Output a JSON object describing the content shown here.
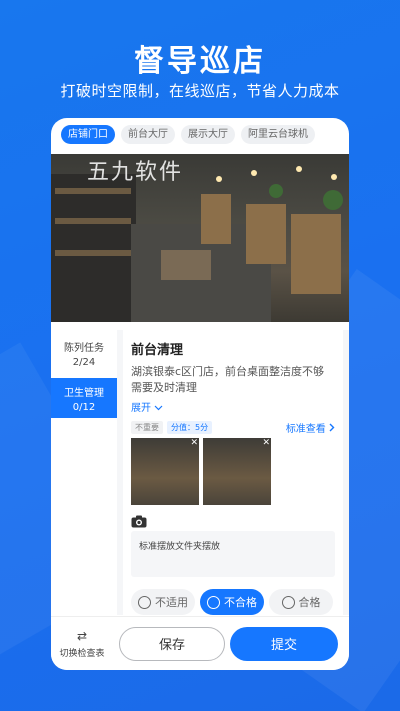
{
  "hero": {
    "title": "督导巡店",
    "subtitle": "打破时空限制，在线巡店，节省人力成本"
  },
  "tabs": [
    {
      "label": "店铺门口",
      "active": true
    },
    {
      "label": "前台大厅",
      "active": false
    },
    {
      "label": "展示大厅",
      "active": false
    },
    {
      "label": "阿里云台球机",
      "active": false
    }
  ],
  "video": {
    "watermark": "五九软件"
  },
  "sidebar": {
    "items": [
      {
        "label": "陈列任务",
        "count": "2/24",
        "active": false
      },
      {
        "label": "卫生管理",
        "count": "0/12",
        "active": true
      }
    ]
  },
  "task": {
    "title": "前台清理",
    "description": "湖滨银泰c区门店，前台桌面整洁度不够需要及时清理",
    "expand_label": "展开",
    "importance_tag": "不重要",
    "score_tag": "分值：5分",
    "standard_link": "标准查看",
    "note_text": "标准摆放文件夹摆放",
    "results": [
      {
        "label": "不适用",
        "selected": false
      },
      {
        "label": "不合格",
        "selected": true
      },
      {
        "label": "合格",
        "selected": false
      }
    ]
  },
  "bottom_bar": {
    "switch_label": "切换检查表",
    "save_label": "保存",
    "submit_label": "提交"
  },
  "colors": {
    "primary": "#1677ff",
    "background": "#1a72ee"
  }
}
